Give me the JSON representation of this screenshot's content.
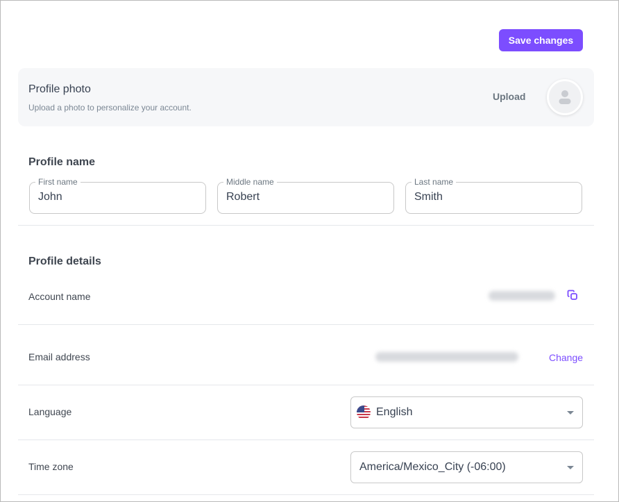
{
  "toolbar": {
    "save_label": "Save changes"
  },
  "photo": {
    "title": "Profile photo",
    "subtitle": "Upload a photo to personalize your account.",
    "upload_label": "Upload",
    "avatar_icon": "user-icon"
  },
  "profile_name": {
    "title": "Profile name",
    "fields": [
      {
        "label": "First name",
        "value": "John"
      },
      {
        "label": "Middle name",
        "value": "Robert"
      },
      {
        "label": "Last name",
        "value": "Smith"
      }
    ]
  },
  "profile_details": {
    "title": "Profile details",
    "account_name": {
      "label": "Account name",
      "value_state": "blurred",
      "copy_icon": "copy-icon"
    },
    "email": {
      "label": "Email address",
      "value_state": "blurred",
      "change_label": "Change"
    },
    "language": {
      "label": "Language",
      "selected": "English",
      "flag_icon": "us-flag-icon"
    },
    "timezone": {
      "label": "Time zone",
      "selected": "America/Mexico_City (-06:00)"
    }
  },
  "colors": {
    "accent": "#7c4dff",
    "card_bg": "#f6f7f9",
    "border": "#c8c8c8"
  }
}
